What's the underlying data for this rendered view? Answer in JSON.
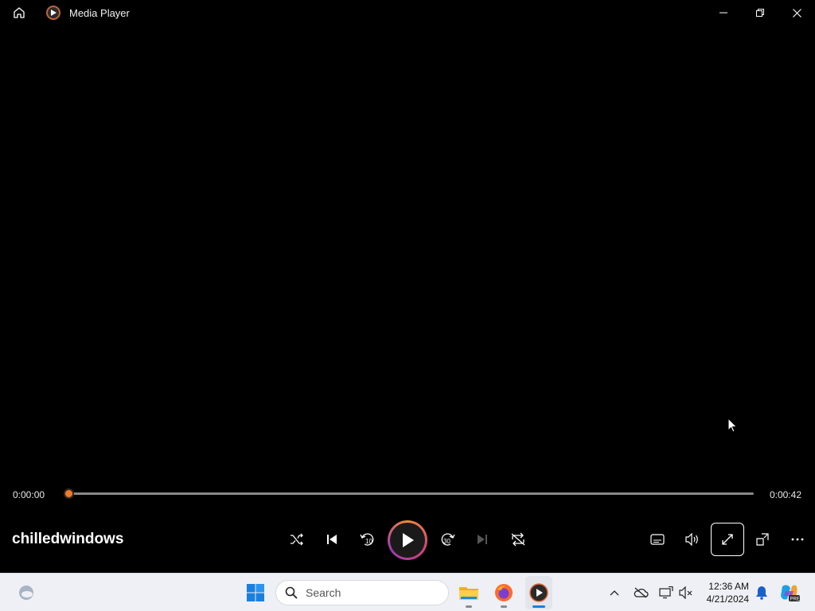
{
  "window": {
    "title": "Media Player",
    "home_icon": "home-icon",
    "minimize_icon": "minimize-icon",
    "restore_icon": "restore-icon",
    "close_icon": "close-icon"
  },
  "player": {
    "current_time": "0:00:00",
    "duration": "0:00:42",
    "progress": 0.0,
    "track_title": "chilledwindows",
    "accent_color": "#f07a2c",
    "buttons": {
      "shuffle": "shuffle-icon",
      "previous": "previous-icon",
      "skip_back": "skip-back-10-icon",
      "play": "play-icon",
      "skip_forward": "skip-forward-30-icon",
      "next": "next-icon",
      "repeat": "repeat-icon",
      "captions": "captions-icon",
      "volume": "volume-icon",
      "fullscreen": "fullscreen-icon",
      "miniplayer": "miniplayer-icon",
      "more": "more-icon"
    }
  },
  "taskbar": {
    "search_placeholder": "Search",
    "time": "12:36 AM",
    "date": "4/21/2024",
    "apps": [
      "file-explorer-icon",
      "firefox-icon",
      "media-player-icon"
    ],
    "tray": [
      "chevron-up-icon",
      "onedrive-icon",
      "network-icon",
      "volume-muted-icon",
      "notification-bell-icon",
      "copilot-icon"
    ]
  }
}
